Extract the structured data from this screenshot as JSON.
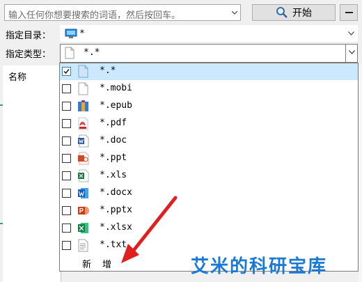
{
  "search": {
    "placeholder": "输入任何你想要搜索的词语，然后按回车。",
    "start_label": "开始"
  },
  "filters": {
    "dir_label": "指定目录：",
    "dir_value": "*",
    "type_label": "指定类型：",
    "type_value": "*.*"
  },
  "results": {
    "column_name": "名称"
  },
  "type_list": {
    "items": [
      {
        "label": "*.*",
        "checked": true,
        "icon": "generic-file-icon"
      },
      {
        "label": "*.mobi",
        "checked": false,
        "icon": "blank-file-icon"
      },
      {
        "label": "*.epub",
        "checked": false,
        "icon": "archive-file-icon"
      },
      {
        "label": "*.pdf",
        "checked": false,
        "icon": "pdf-file-icon"
      },
      {
        "label": "*.doc",
        "checked": false,
        "icon": "word-doc-icon"
      },
      {
        "label": "*.ppt",
        "checked": false,
        "icon": "powerpoint-ppt-icon"
      },
      {
        "label": "*.xls",
        "checked": false,
        "icon": "excel-xls-icon"
      },
      {
        "label": "*.docx",
        "checked": false,
        "icon": "word-docx-icon"
      },
      {
        "label": "*.pptx",
        "checked": false,
        "icon": "powerpoint-pptx-icon"
      },
      {
        "label": "*.xlsx",
        "checked": false,
        "icon": "excel-xlsx-icon"
      },
      {
        "label": "*.txt",
        "checked": false,
        "icon": "text-file-icon"
      }
    ],
    "new_label": "新增"
  },
  "watermark": "艾米的科研宝库",
  "colors": {
    "selection": "#cce8ff",
    "watermark": "#1b79d6",
    "arrow": "#e02020"
  }
}
